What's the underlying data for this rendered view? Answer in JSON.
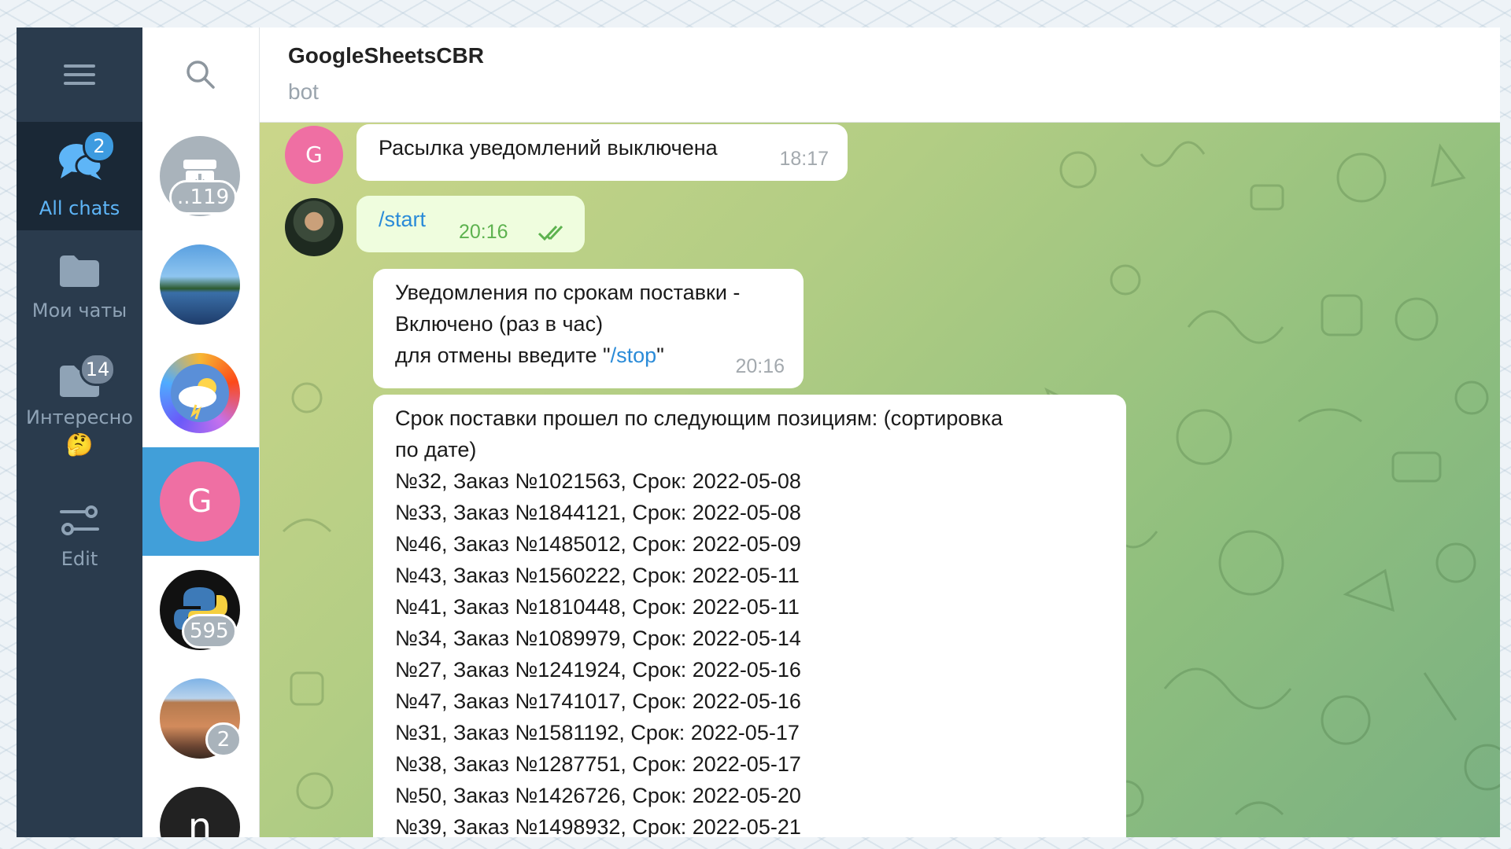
{
  "rail": {
    "folders": [
      {
        "label": "All chats",
        "badge": "2"
      },
      {
        "label": "Мои чаты"
      },
      {
        "label": "Интересно",
        "emoji": "🤔",
        "badge": "14"
      },
      {
        "label": "Edit"
      }
    ]
  },
  "chatlist": {
    "chats": [
      {
        "kind": "archive",
        "count": "..119"
      },
      {
        "kind": "lake-photo"
      },
      {
        "kind": "weather-app"
      },
      {
        "kind": "letter",
        "letter": "G",
        "active": true
      },
      {
        "kind": "python",
        "count": "595"
      },
      {
        "kind": "building-photo",
        "count": "2"
      },
      {
        "kind": "letter-dark",
        "letter": "n"
      }
    ]
  },
  "header": {
    "title": "GoogleSheetsCBR",
    "subtitle": "bot"
  },
  "messages": [
    {
      "text": "Расылка уведомлений выключена",
      "time": "18:17",
      "avatar_letter": "G"
    },
    {
      "text": "/start",
      "time": "20:16"
    },
    {
      "line1": "Уведомления по срокам поставки -",
      "line2": "Включено (раз в час)",
      "line3_prefix": "для отмены введите \"",
      "line3_link": "/stop",
      "line3_suffix": "\"",
      "time": "20:16"
    },
    {
      "heading1": "Срок поставки прошел по следующим позициям: (сортировка",
      "heading2": "по дате)",
      "orders": [
        "№32, Заказ №1021563, Срок: 2022-05-08",
        "№33, Заказ №1844121, Срок: 2022-05-08",
        "№46, Заказ №1485012, Срок: 2022-05-09",
        "№43, Заказ №1560222, Срок: 2022-05-11",
        "№41, Заказ №1810448, Срок: 2022-05-11",
        "№34, Заказ №1089979, Срок: 2022-05-14",
        "№27, Заказ №1241924, Срок: 2022-05-16",
        "№47, Заказ №1741017, Срок: 2022-05-16",
        "№31, Заказ №1581192, Срок: 2022-05-17",
        "№38, Заказ №1287751, Срок: 2022-05-17",
        "№50, Заказ №1426726, Срок: 2022-05-20",
        "№39, Заказ №1498932, Срок: 2022-05-21"
      ]
    }
  ],
  "colors": {
    "rail": "#2a3b4d",
    "accent": "#419fd9",
    "link": "#2a8bd8",
    "outgoing": "#effdde"
  }
}
